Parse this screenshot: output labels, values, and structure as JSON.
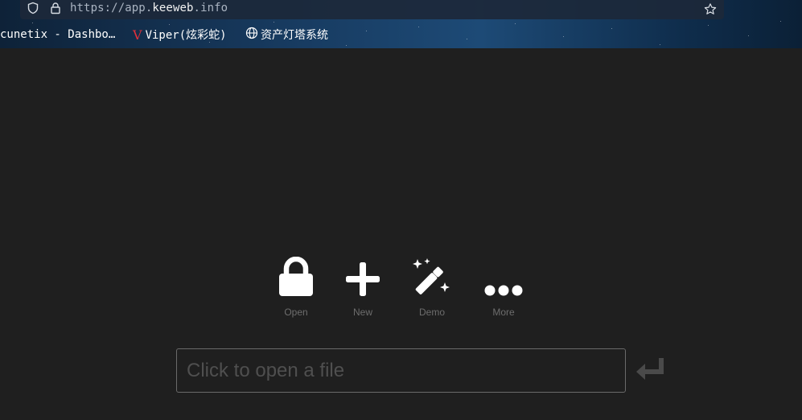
{
  "browser": {
    "url_prefix": "https://app.",
    "url_domain": "keeweb",
    "url_suffix": ".info",
    "icons": [
      "shield-icon",
      "lock-icon",
      "star-icon"
    ]
  },
  "bookmarks": [
    {
      "label": "cunetix - Dashbo…"
    },
    {
      "label": "Viper(炫彩蛇)",
      "icon_letter": "V"
    },
    {
      "label": "资产灯塔系统",
      "icon": "globe-icon"
    }
  ],
  "actions": [
    {
      "label": "Open",
      "icon": "lock-icon"
    },
    {
      "label": "New",
      "icon": "plus-icon"
    },
    {
      "label": "Demo",
      "icon": "magic-wand-icon"
    },
    {
      "label": "More",
      "icon": "ellipsis-icon"
    }
  ],
  "open_file": {
    "placeholder": "Click to open a file",
    "value": ""
  },
  "colors": {
    "background": "#1f1f1f",
    "icon": "#ffffff",
    "label": "#6d6d6d",
    "input_border": "#6a6a6a",
    "enter_icon": "#4a4a4a",
    "bookmark_accent": "#e0303a"
  }
}
